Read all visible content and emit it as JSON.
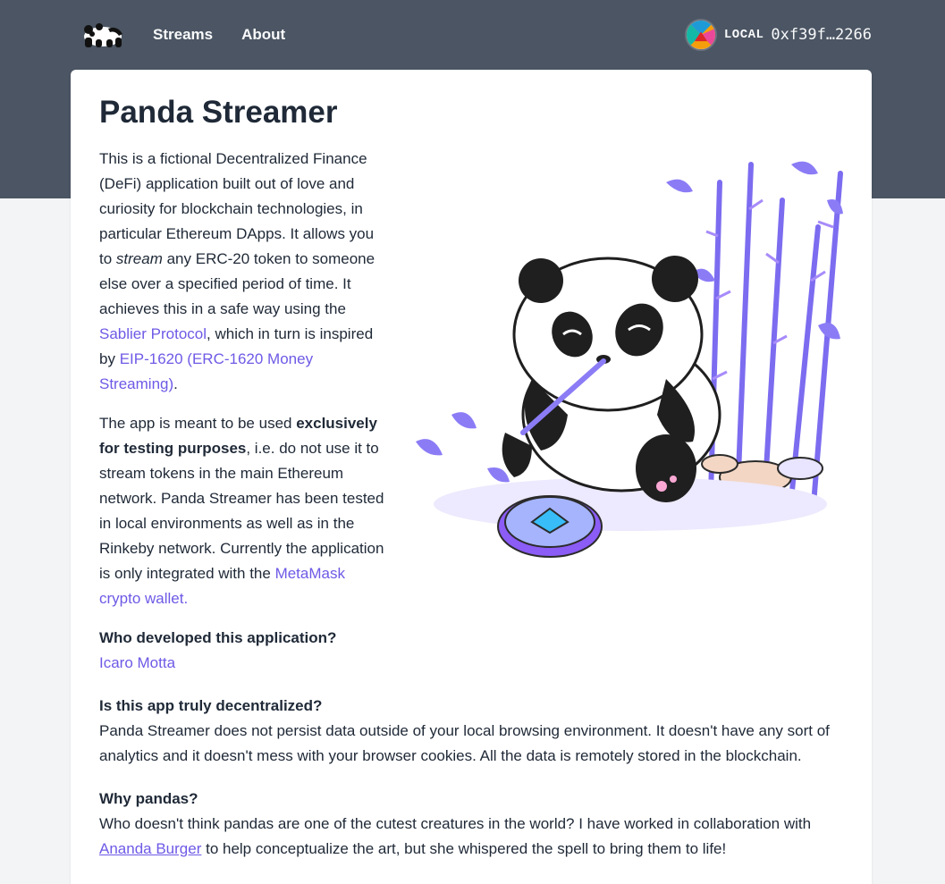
{
  "header": {
    "logo_icon": "panda-logo-icon",
    "nav": [
      {
        "label": "Streams"
      },
      {
        "label": "About"
      }
    ],
    "wallet": {
      "avatar_icon": "wallet-avatar-icon",
      "network": "LOCAL",
      "address": "0xf39f…2266"
    }
  },
  "page": {
    "title": "Panda Streamer",
    "intro": {
      "p1_a": "This is a fictional Decentralized Finance (DeFi) application built out of love and curiosity for blockchain technologies, in particular Ethereum DApps. It allows you to ",
      "p1_em": "stream",
      "p1_b": " any ERC-20 token to someone else over a specified period of time. It achieves this in a safe way using the ",
      "p1_link1": "Sablier Protocol",
      "p1_c": ", which in turn is inspired by ",
      "p1_link2": "EIP-1620 (ERC-1620 Money Streaming)",
      "p1_d": ".",
      "p2_a": "The app is meant to be used ",
      "p2_strong": "exclusively for testing purposes",
      "p2_b": ", i.e. do not use it to stream tokens in the main Ethereum network. Panda Streamer has been tested in local environments as well as in the Rinkeby network. Currently the application is only integrated with the ",
      "p2_link": "MetaMask crypto wallet.",
      "p2_c": ""
    },
    "faq": [
      {
        "q": "Who developed this application?",
        "a_link": "Icaro Motta"
      },
      {
        "q": "Is this app truly decentralized?",
        "a": "Panda Streamer does not persist data outside of your local browsing environment. It doesn't have any sort of analytics and it doesn't mess with your browser cookies. All the data is remotely stored in the blockchain."
      },
      {
        "q": "Why pandas?",
        "a_a": "Who doesn't think pandas are one of the cutest creatures in the world? I have worked in collaboration with ",
        "a_link": "Ananda Burger",
        "a_b": " to help conceptualize the art, but she whispered the spell to bring them to life!"
      }
    ],
    "illustration_icon": "panda-bamboo-illustration"
  },
  "colors": {
    "header_bg": "#4b5563",
    "link": "#6d5ae6",
    "page_bg": "#f3f4f6"
  }
}
